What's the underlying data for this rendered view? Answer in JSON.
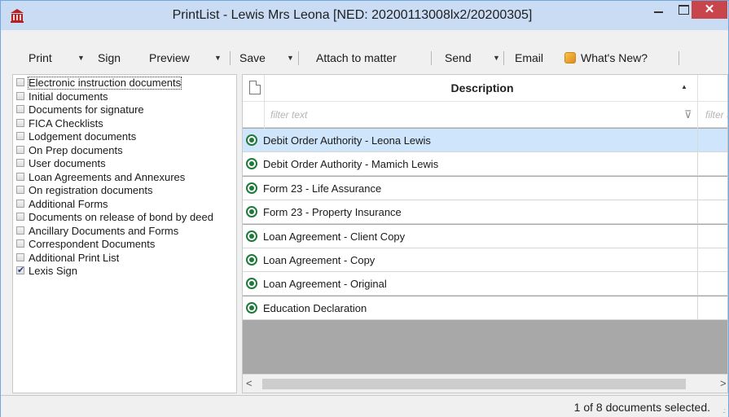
{
  "window": {
    "title": "PrintList - Lewis Mrs Leona [NED: 20200113008lx2/20200305]",
    "close_glyph": "✕"
  },
  "toolbar": {
    "print": "Print",
    "sign": "Sign",
    "preview": "Preview",
    "save": "Save",
    "attach": "Attach to matter",
    "send": "Send",
    "email": "Email",
    "whats_new": "What's New?",
    "dropdown_glyph": "▼"
  },
  "checklist": [
    {
      "label": "Electronic instruction documents",
      "checked": false
    },
    {
      "label": "Initial documents",
      "checked": false
    },
    {
      "label": "Documents for signature",
      "checked": false
    },
    {
      "label": "FICA Checklists",
      "checked": false
    },
    {
      "label": "Lodgement documents",
      "checked": false
    },
    {
      "label": "On Prep documents",
      "checked": false
    },
    {
      "label": "User documents",
      "checked": false
    },
    {
      "label": "Loan Agreements and Annexures",
      "checked": false
    },
    {
      "label": "On registration documents",
      "checked": false
    },
    {
      "label": "Additional Forms",
      "checked": false
    },
    {
      "label": "Documents on release of bond by deed",
      "checked": false
    },
    {
      "label": "Ancillary Documents and Forms",
      "checked": false
    },
    {
      "label": "Correspondent Documents",
      "checked": false
    },
    {
      "label": "Additional Print List",
      "checked": false
    },
    {
      "label": "Lexis Sign",
      "checked": true
    }
  ],
  "grid": {
    "header": "Description",
    "sort_glyph": "▲",
    "filter_placeholder": "filter text",
    "filter_placeholder_2": "filter t",
    "filter_glyph": "⊽",
    "rows": [
      {
        "text": "Debit Order Authority - Leona Lewis",
        "selected": true
      },
      {
        "text": "Debit Order Authority - Mamich Lewis",
        "selected": false
      },
      {
        "text": "Form 23 - Life Assurance",
        "selected": false
      },
      {
        "text": "Form 23 - Property Insurance",
        "selected": false
      },
      {
        "text": "Loan Agreement - Client Copy",
        "selected": false
      },
      {
        "text": "Loan Agreement - Copy",
        "selected": false
      },
      {
        "text": "Loan Agreement - Original",
        "selected": false
      },
      {
        "text": "Education Declaration",
        "selected": false
      }
    ],
    "scroll_left": "<",
    "scroll_right": ">"
  },
  "status": {
    "text": "1 of 8 documents selected.",
    "grip": ".:"
  },
  "colors": {
    "titlebar": "#c9dcf4",
    "close": "#c7454b",
    "selected_row": "#cfe5fb",
    "row_icon": "#1f7a3a"
  }
}
